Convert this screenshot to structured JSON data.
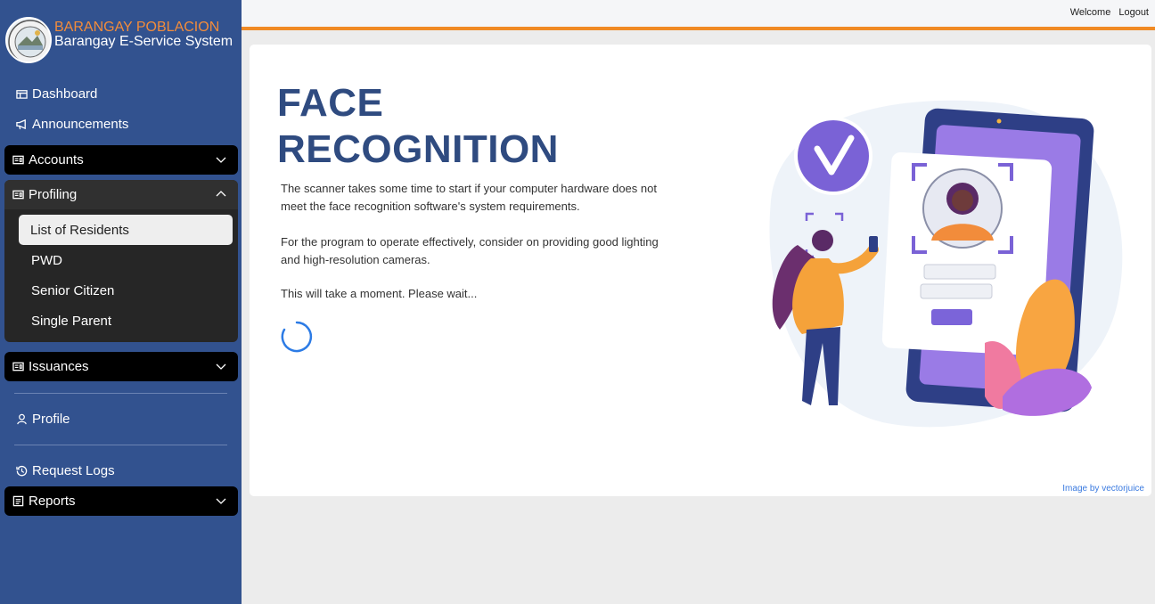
{
  "brand": {
    "line1": "BARANGAY POBLACION",
    "line2": "Barangay E-Service System"
  },
  "topbar": {
    "welcome": "Welcome",
    "logout": "Logout"
  },
  "sidebar": {
    "dashboard": "Dashboard",
    "announcements": "Announcements",
    "accounts": "Accounts",
    "profiling": {
      "label": "Profiling",
      "items": [
        "List of Residents",
        "PWD",
        "Senior Citizen",
        "Single Parent"
      ]
    },
    "issuances": "Issuances",
    "profile": "Profile",
    "request_logs": "Request Logs",
    "reports": "Reports"
  },
  "main": {
    "title_line1": "FACE",
    "title_line2": "RECOGNITION",
    "para1": "The scanner takes some time to start if your computer hardware does not meet the face recognition software's system requirements.",
    "para2": "For the program to operate effectively, consider on providing good lighting and high-resolution cameras.",
    "para3": "This will take a moment. Please wait...",
    "credit": "Image by vectorjuice"
  },
  "colors": {
    "sidebar": "#32528f",
    "accent_orange": "#f08a24",
    "title": "#2f4b80",
    "spinner": "#2c7be5"
  },
  "icons": [
    "dashboard-icon",
    "megaphone-icon",
    "id-card-icon",
    "chevron-down-icon",
    "chevron-up-icon",
    "user-icon",
    "history-icon",
    "report-icon"
  ]
}
